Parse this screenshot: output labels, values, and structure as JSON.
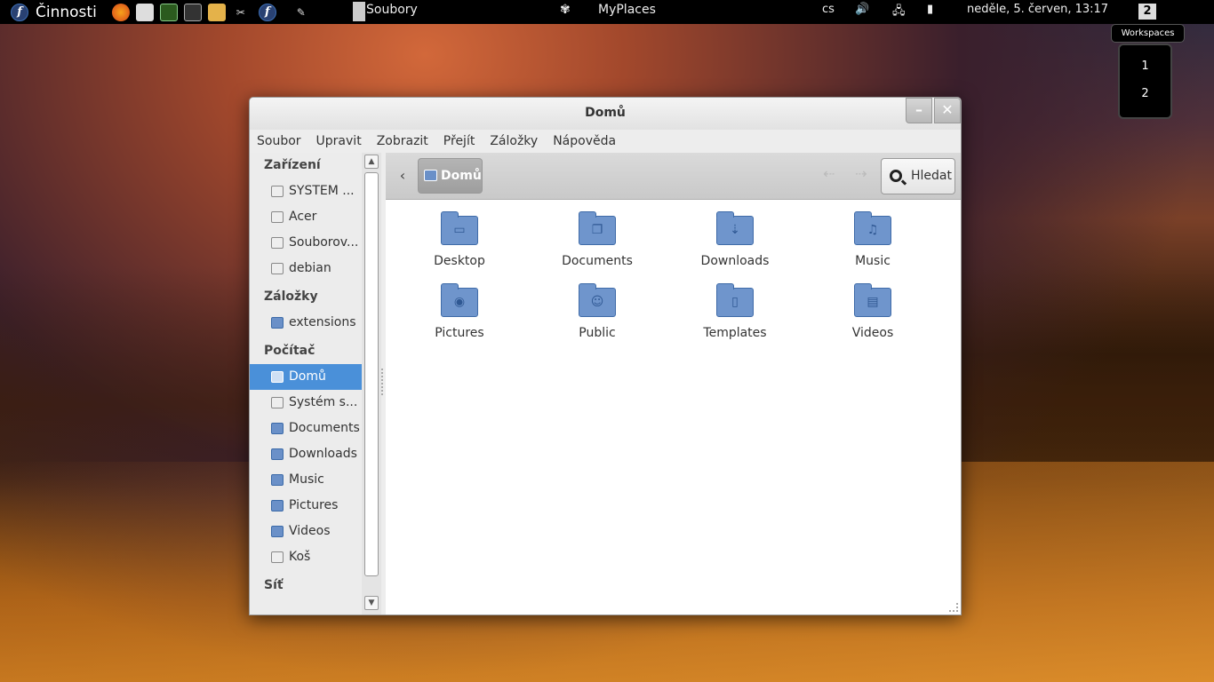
{
  "panel": {
    "activities": "Činnosti",
    "app_name": "Soubory",
    "myplaces": "MyPlaces",
    "lang": "cs",
    "clock": "neděle,  5. červen, 13:17",
    "workspace_current": "2"
  },
  "tooltip": "Workspaces",
  "workspaces": [
    "1",
    "2"
  ],
  "window": {
    "title": "Domů",
    "min_label": "–",
    "close_label": "✕",
    "menu": [
      "Soubor",
      "Upravit",
      "Zobrazit",
      "Přejít",
      "Záložky",
      "Nápověda"
    ]
  },
  "sidebar": {
    "sections": [
      {
        "heading": "Zařízení",
        "items": [
          "SYSTEM ...",
          "Acer",
          "Souborov...",
          "debian"
        ]
      },
      {
        "heading": "Záložky",
        "items": [
          "extensions"
        ]
      },
      {
        "heading": "Počítač",
        "items": [
          "Domů",
          "Systém s...",
          "Documents",
          "Downloads",
          "Music",
          "Pictures",
          "Videos",
          "Koš"
        ]
      },
      {
        "heading": "Síť",
        "items": []
      }
    ],
    "active": "Domů"
  },
  "toolbar": {
    "crumb": "Domů",
    "search": "Hledat"
  },
  "files": [
    {
      "name": "Desktop",
      "glyph": "▭"
    },
    {
      "name": "Documents",
      "glyph": "❐"
    },
    {
      "name": "Downloads",
      "glyph": "⇣"
    },
    {
      "name": "Music",
      "glyph": "♫"
    },
    {
      "name": "Pictures",
      "glyph": "◉"
    },
    {
      "name": "Public",
      "glyph": "☺"
    },
    {
      "name": "Templates",
      "glyph": "▯"
    },
    {
      "name": "Videos",
      "glyph": "▤"
    }
  ]
}
